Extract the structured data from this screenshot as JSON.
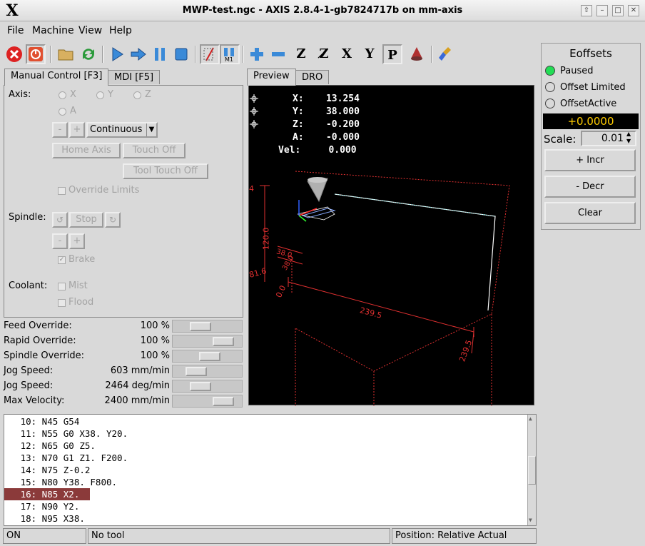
{
  "window": {
    "title": "MWP-test.ngc - AXIS 2.8.4-1-gb7824717b on mm-axis",
    "logo": "X"
  },
  "menu": [
    "File",
    "Machine",
    "View",
    "Help"
  ],
  "tabs_left": {
    "manual": "Manual Control [F3]",
    "mdi": "MDI [F5]"
  },
  "tabs_right": {
    "preview": "Preview",
    "dro": "DRO"
  },
  "manual": {
    "axis_label": "Axis:",
    "axes": [
      "X",
      "Y",
      "Z",
      "A"
    ],
    "jog_minus": "-",
    "jog_plus": "+",
    "jog_mode": "Continuous",
    "home_axis": "Home Axis",
    "touch_off": "Touch Off",
    "tool_touch_off": "Tool Touch Off",
    "override_limits": "Override Limits",
    "spindle_label": "Spindle:",
    "spindle_stop": "Stop",
    "spindle_minus": "-",
    "spindle_plus": "+",
    "brake": "Brake",
    "coolant_label": "Coolant:",
    "mist": "Mist",
    "flood": "Flood"
  },
  "overrides": [
    {
      "label": "Feed Override:",
      "value": "100 %",
      "level": 0.35
    },
    {
      "label": "Rapid Override:",
      "value": "100 %",
      "level": 0.85
    },
    {
      "label": "Spindle Override:",
      "value": "100 %",
      "level": 0.55
    },
    {
      "label": "Jog Speed:",
      "value": "603 mm/min",
      "level": 0.25
    },
    {
      "label": "Jog Speed:",
      "value": "2464 deg/min",
      "level": 0.35
    },
    {
      "label": "Max Velocity:",
      "value": "2400 mm/min",
      "level": 0.85
    }
  ],
  "dro": {
    "x": "X:    13.254",
    "y": "Y:    38.000",
    "z": "Z:    -0.200",
    "a": "A:    -0.000",
    "vel": "Vel:     0.000"
  },
  "preview_labels": {
    "dim_z": "4",
    "dim_120": "120.0",
    "dim_38a": "38.0",
    "dim_38b": "38.0",
    "dim_816": "81.6",
    "dim_0": "0.0",
    "dim_2395a": "239.5",
    "dim_2395b": "239.5"
  },
  "gcode": [
    "   10: N45 G54",
    "   11: N55 G0 X38. Y20.",
    "   12: N65 G0 Z5.",
    "   13: N70 G1 Z1. F200.",
    "   14: N75 Z-0.2",
    "   15: N80 Y38. F800.",
    "   16: N85 X2.",
    "   17: N90 Y2.",
    "   18: N95 X38."
  ],
  "highlighted_line": 6,
  "status": {
    "state": "ON",
    "tool": "No tool",
    "position": "Position: Relative Actual"
  },
  "eoffsets": {
    "title": "Eoffsets",
    "paused": "Paused",
    "offset_limited": "Offset Limited",
    "offset_active": "OffsetActive",
    "value": "+0.0000",
    "scale_label": "Scale:",
    "scale_value": "0.01",
    "incr": "+ Incr",
    "decr": "- Decr",
    "clear": "Clear"
  },
  "colors": {
    "paused_led": "#22dd55",
    "eoffset_value": "#ffcc00",
    "highlight": "#8b3a3a",
    "estop": "#dd2222"
  }
}
